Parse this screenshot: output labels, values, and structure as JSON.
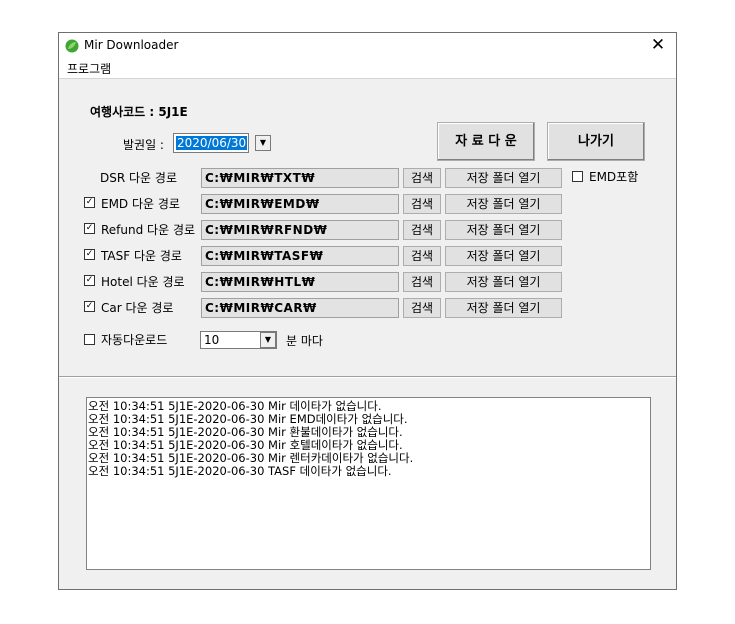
{
  "window": {
    "title": "Mir Downloader",
    "close_glyph": "✕"
  },
  "menu": {
    "program": "프로그램"
  },
  "agency": {
    "label": "여행사코드 : 5J1E"
  },
  "issue_date": {
    "label": "발권일 :",
    "value": "2020/06/30"
  },
  "buttons": {
    "download": "자 료 다 운",
    "exit": "나가기"
  },
  "rows": [
    {
      "label": "DSR 다운 경로",
      "path": "C:₩MIR₩TXT₩",
      "checkbox": false,
      "checked": false
    },
    {
      "label": "EMD 다운 경로",
      "path": "C:₩MIR₩EMD₩",
      "checkbox": true,
      "checked": true
    },
    {
      "label": "Refund 다운 경로",
      "path": "C:₩MIR₩RFND₩",
      "checkbox": true,
      "checked": true
    },
    {
      "label": "TASF 다운 경로",
      "path": "C:₩MIR₩TASF₩",
      "checkbox": true,
      "checked": true
    },
    {
      "label": "Hotel 다운 경로",
      "path": "C:₩MIR₩HTL₩",
      "checkbox": true,
      "checked": true
    },
    {
      "label": "Car 다운 경로",
      "path": "C:₩MIR₩CAR₩",
      "checkbox": true,
      "checked": true
    }
  ],
  "row_buttons": {
    "search": "검색",
    "open_folder": "저장 폴더 열기"
  },
  "emd_include": {
    "label": "EMD포함",
    "checked": false
  },
  "auto_download": {
    "label": "자동다운로드",
    "checked": false,
    "interval": "10",
    "unit": "분 마다"
  },
  "log": [
    "오전 10:34:51 5J1E-2020-06-30 Mir 데이타가 없습니다.",
    "오전 10:34:51 5J1E-2020-06-30 Mir EMD데이타가 없습니다.",
    "오전 10:34:51 5J1E-2020-06-30 Mir 환불데이타가 없습니다.",
    "오전 10:34:51 5J1E-2020-06-30 Mir 호텔데이타가 없습니다.",
    "오전 10:34:51 5J1E-2020-06-30 Mir 렌터카데이타가 없습니다.",
    "오전 10:34:51 5J1E-2020-06-30 TASF 데이타가 없습니다."
  ],
  "icons": {
    "app": "leaf-icon",
    "dropdown": "chevron-down-icon",
    "check": "✓"
  },
  "colors": {
    "selection": "#0078d7",
    "path_bg": "#e3e3e3",
    "window_bg": "#f0f0f0"
  }
}
